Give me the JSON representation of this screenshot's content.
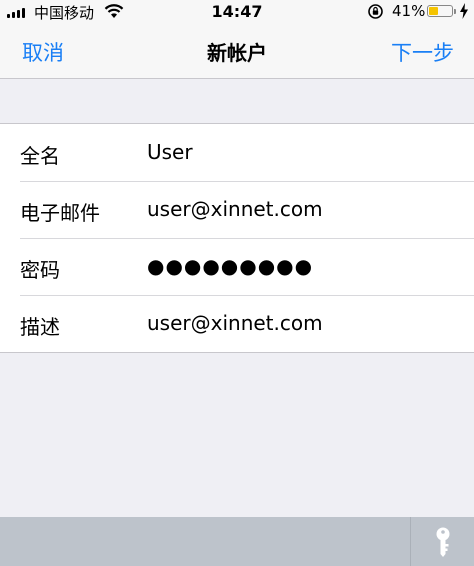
{
  "status_bar": {
    "carrier": "中国移动",
    "time": "14:47",
    "battery_percent": "41%",
    "battery_level": 0.41,
    "battery_color": "#f5c400"
  },
  "nav": {
    "cancel_label": "取消",
    "title": "新帐户",
    "next_label": "下一步",
    "accent_color": "#1a7ff5"
  },
  "form": {
    "rows": [
      {
        "label": "全名",
        "value": "User"
      },
      {
        "label": "电子邮件",
        "value": "user@xinnet.com"
      },
      {
        "label": "密码",
        "value": "●●●●●●●●●"
      },
      {
        "label": "描述",
        "value": "user@xinnet.com"
      }
    ]
  },
  "keyboard_bar": {
    "icon": "key-icon"
  }
}
